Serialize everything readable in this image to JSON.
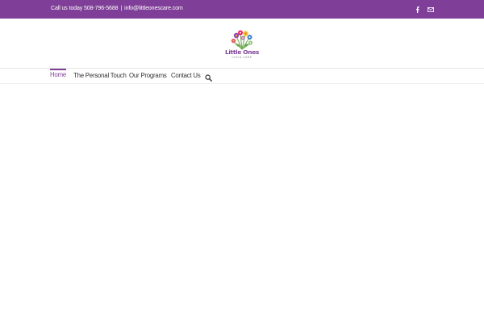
{
  "topbar": {
    "phone_text": "Call us today 508-796-5688",
    "separator": "|",
    "email_text": "info@littleonescare.com",
    "background_color": "#7f3f98",
    "social_icons": [
      "facebook-icon",
      "mail-icon"
    ]
  },
  "logo": {
    "title": "Little Ones",
    "subtitle": "CHILD CARE",
    "brand_color": "#7f3f98"
  },
  "nav": {
    "items": [
      {
        "label": "Home",
        "active": true
      },
      {
        "label": "The Personal Touch",
        "active": false
      },
      {
        "label": "Our Programs",
        "active": false
      },
      {
        "label": "Contact Us",
        "active": false
      }
    ],
    "search_icon": "search-icon",
    "active_color": "#7f3f98",
    "text_color": "#333333"
  }
}
